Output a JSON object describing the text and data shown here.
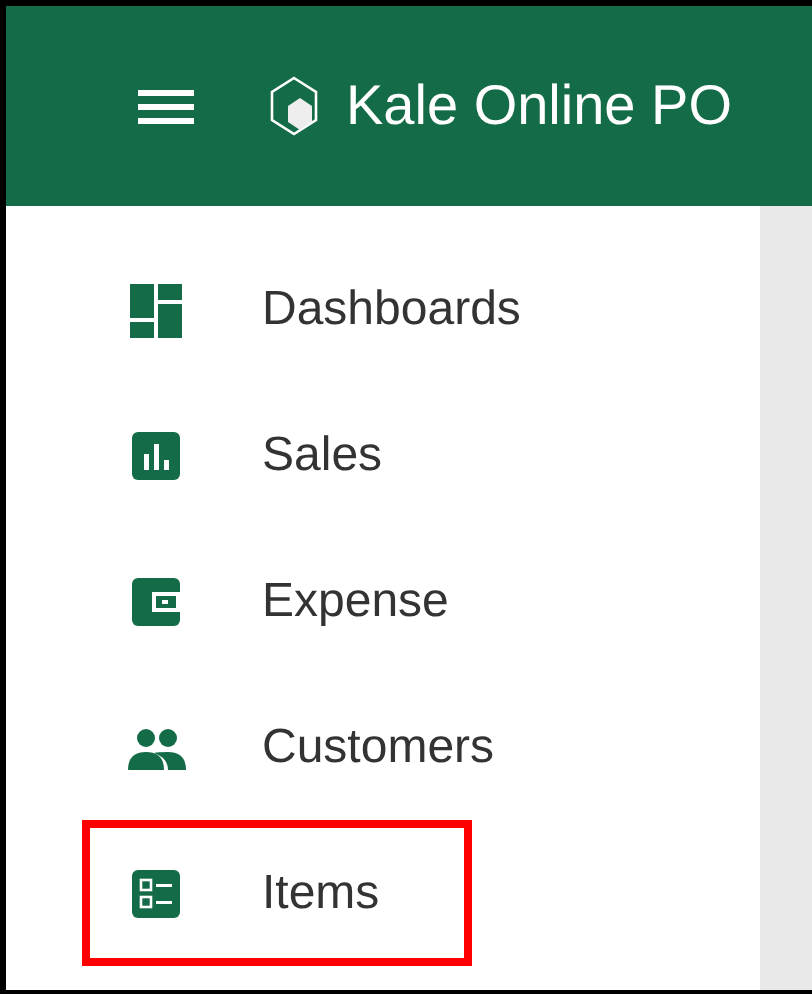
{
  "header": {
    "title": "Kale Online PO"
  },
  "sidebar": {
    "items": [
      {
        "label": "Dashboards",
        "kind": "dashboard",
        "highlighted": false
      },
      {
        "label": "Sales",
        "kind": "sales",
        "highlighted": false
      },
      {
        "label": "Expense",
        "kind": "expense",
        "highlighted": false
      },
      {
        "label": "Customers",
        "kind": "customers",
        "highlighted": false
      },
      {
        "label": "Items",
        "kind": "items",
        "highlighted": true
      }
    ]
  }
}
